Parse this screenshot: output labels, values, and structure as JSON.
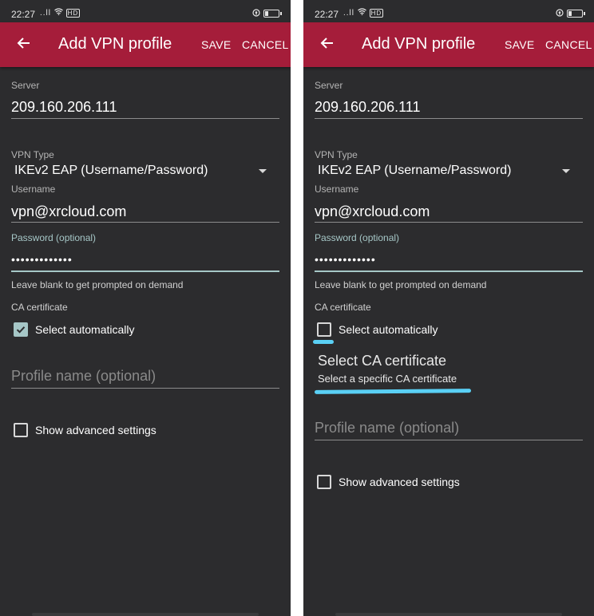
{
  "status_bar": {
    "time": "22:27",
    "signal_text": "..ll",
    "network_text": "HD"
  },
  "app_bar": {
    "title": "Add VPN profile",
    "save_label": "SAVE",
    "cancel_label": "CANCEL",
    "color": "#a51d3a"
  },
  "form": {
    "server_label": "Server",
    "server_value": "209.160.206.111",
    "vpn_type_label": "VPN Type",
    "vpn_type_value": "IKEv2 EAP (Username/Password)",
    "username_label": "Username",
    "username_value": "vpn@xrcloud.com",
    "password_label": "Password (optional)",
    "password_masked": "•••••••••••••",
    "password_helper": "Leave blank to get prompted on demand",
    "ca_label": "CA certificate",
    "select_auto_label": "Select automatically",
    "profile_name_placeholder": "Profile name (optional)",
    "advanced_label": "Show advanced settings"
  },
  "right_panel": {
    "select_auto_checked": false,
    "ca_select_title": "Select CA certificate",
    "ca_select_subtitle": "Select a specific CA certificate",
    "annotation_color": "#5ad0f5"
  },
  "left_panel": {
    "select_auto_checked": true
  },
  "colors": {
    "background": "#2c2c2e",
    "accent": "#a6c7c7"
  }
}
